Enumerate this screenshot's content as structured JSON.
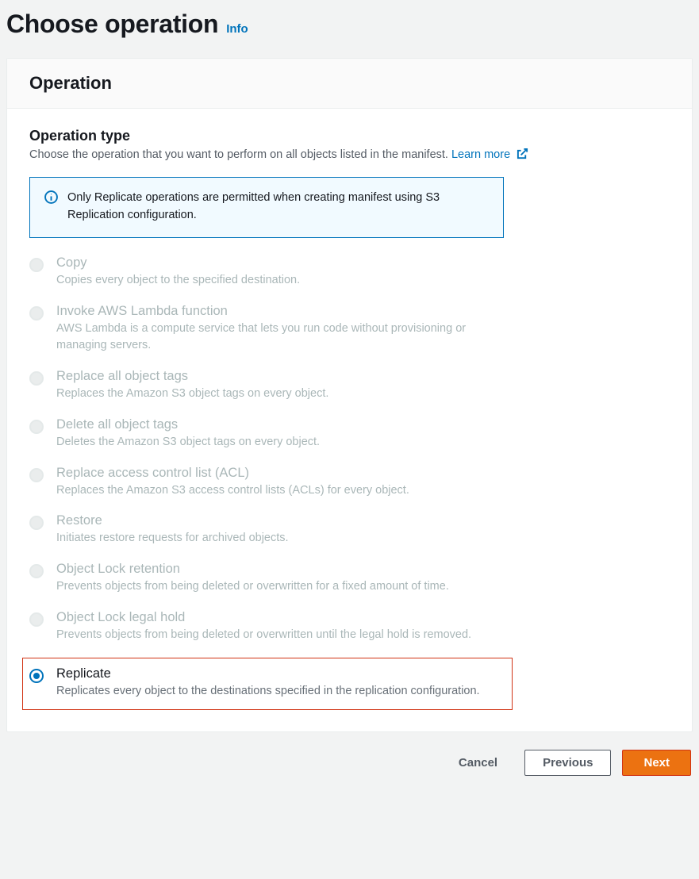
{
  "header": {
    "title": "Choose operation",
    "info_link": "Info"
  },
  "panel": {
    "title": "Operation"
  },
  "operation_type": {
    "title": "Operation type",
    "description": "Choose the operation that you want to perform on all objects listed in the manifest.",
    "learn_more": "Learn more"
  },
  "alert": {
    "text": "Only Replicate operations are permitted when creating manifest using S3 Replication configuration."
  },
  "options": [
    {
      "key": "copy",
      "title": "Copy",
      "description": "Copies every object to the specified destination.",
      "enabled": false,
      "selected": false
    },
    {
      "key": "invoke-lambda",
      "title": "Invoke AWS Lambda function",
      "description": "AWS Lambda is a compute service that lets you run code without provisioning or managing servers.",
      "enabled": false,
      "selected": false
    },
    {
      "key": "replace-tags",
      "title": "Replace all object tags",
      "description": "Replaces the Amazon S3 object tags on every object.",
      "enabled": false,
      "selected": false
    },
    {
      "key": "delete-tags",
      "title": "Delete all object tags",
      "description": "Deletes the Amazon S3 object tags on every object.",
      "enabled": false,
      "selected": false
    },
    {
      "key": "replace-acl",
      "title": "Replace access control list (ACL)",
      "description": "Replaces the Amazon S3 access control lists (ACLs) for every object.",
      "enabled": false,
      "selected": false
    },
    {
      "key": "restore",
      "title": "Restore",
      "description": "Initiates restore requests for archived objects.",
      "enabled": false,
      "selected": false
    },
    {
      "key": "object-lock-retention",
      "title": "Object Lock retention",
      "description": "Prevents objects from being deleted or overwritten for a fixed amount of time.",
      "enabled": false,
      "selected": false
    },
    {
      "key": "object-lock-legal-hold",
      "title": "Object Lock legal hold",
      "description": "Prevents objects from being deleted or overwritten until the legal hold is removed.",
      "enabled": false,
      "selected": false
    },
    {
      "key": "replicate",
      "title": "Replicate",
      "description": "Replicates every object to the destinations specified in the replication configuration.",
      "enabled": true,
      "selected": true
    }
  ],
  "buttons": {
    "cancel": "Cancel",
    "previous": "Previous",
    "next": "Next"
  }
}
